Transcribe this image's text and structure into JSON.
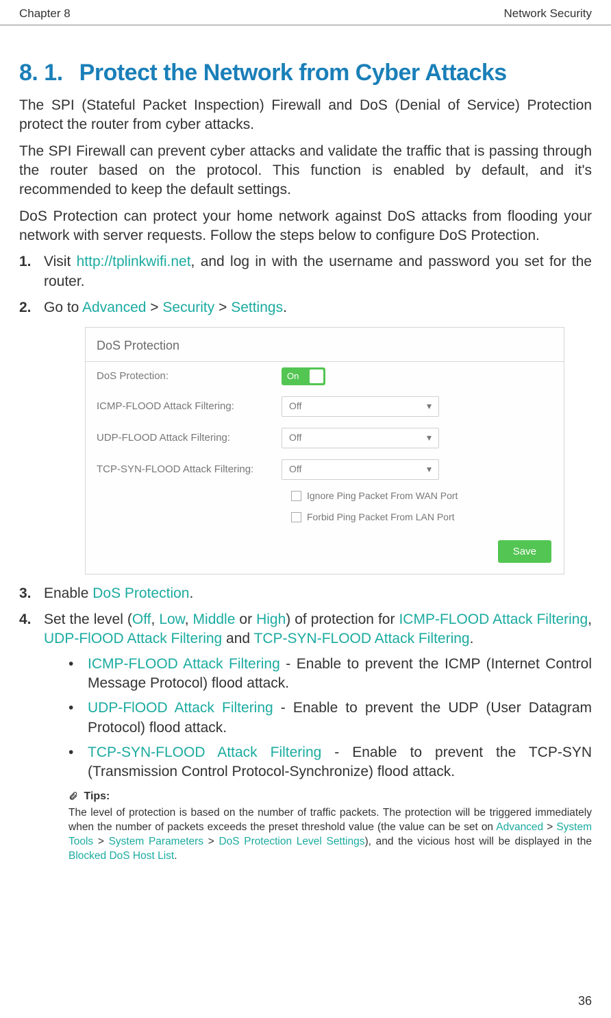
{
  "header": {
    "chapter": "Chapter 8",
    "title": "Network Security"
  },
  "section": {
    "number": "8. 1.",
    "title": "Protect the Network from Cyber Attacks"
  },
  "paragraphs": {
    "p1": "The SPI (Stateful Packet Inspection) Firewall and DoS (Denial of Service) Protection protect the router from cyber attacks.",
    "p2": "The SPI Firewall can prevent cyber attacks and validate the traffic that is passing through the router based on the protocol. This function is enabled by default, and it's recommended to keep the default settings.",
    "p3": "DoS Protection can protect your home network against DoS attacks from flooding your network with server requests. Follow the steps below to configure DoS Protection."
  },
  "steps": {
    "s1": {
      "num": "1.",
      "pre": "Visit ",
      "link": "http://tplinkwifi.net",
      "post": ", and log in with the username and password you set for the router."
    },
    "s2": {
      "num": "2.",
      "pre": "Go to ",
      "a": "Advanced",
      "sep1": " > ",
      "b": "Security",
      "sep2": " > ",
      "c": "Settings",
      "end": "."
    },
    "s3": {
      "num": "3.",
      "pre": "Enable ",
      "kw": "DoS Protection",
      "end": "."
    },
    "s4": {
      "num": "4.",
      "pre": "Set the level (",
      "off": "Off",
      "c1": ", ",
      "low": "Low",
      "c2": ", ",
      "mid": "Middle",
      "c3": " or ",
      "high": "High",
      "mid2": ") of protection for ",
      "icmp": "ICMP-FLOOD Attack Filtering",
      "c4": ", ",
      "udp": "UDP-FlOOD Attack Filtering",
      "and": " and ",
      "tcp": "TCP-SYN-FLOOD Attack Filtering",
      "end": "."
    }
  },
  "bullets": {
    "b1": {
      "kw": "ICMP-FLOOD Attack Filtering",
      "txt": " - Enable to prevent the ICMP (Internet Control Message Protocol) flood attack."
    },
    "b2": {
      "kw": "UDP-FlOOD Attack Filtering",
      "txt": " - Enable to prevent the UDP (User Datagram Protocol) flood attack."
    },
    "b3": {
      "kw": "TCP-SYN-FLOOD Attack Filtering",
      "txt": " - Enable to prevent the TCP-SYN (Transmission Control Protocol-Synchronize) flood attack."
    }
  },
  "tips": {
    "label": "Tips:",
    "pre": "The level of protection is based on the number of traffic packets. The protection will be triggered immediately when the number of packets exceeds the preset threshold value (the value can be set on ",
    "a": "Advanced",
    "s1": " > ",
    "b": "System Tools",
    "s2": " > ",
    "c": "System Parameters",
    "s3": " > ",
    "d": "DoS Protection Level Settings",
    "mid": "), and the vicious host will be displayed in the ",
    "e": "Blocked DoS Host List",
    "end": "."
  },
  "panel": {
    "title": "DoS Protection",
    "rows": {
      "dos": {
        "label": "DoS Protection:",
        "toggle": "On"
      },
      "icmp": {
        "label": "ICMP-FLOOD Attack Filtering:",
        "value": "Off"
      },
      "udp": {
        "label": "UDP-FLOOD Attack Filtering:",
        "value": "Off"
      },
      "tcp": {
        "label": "TCP-SYN-FLOOD Attack Filtering:",
        "value": "Off"
      }
    },
    "checks": {
      "wan": "Ignore Ping Packet From WAN Port",
      "lan": "Forbid Ping Packet From LAN Port"
    },
    "save": "Save"
  },
  "page_number": "36"
}
